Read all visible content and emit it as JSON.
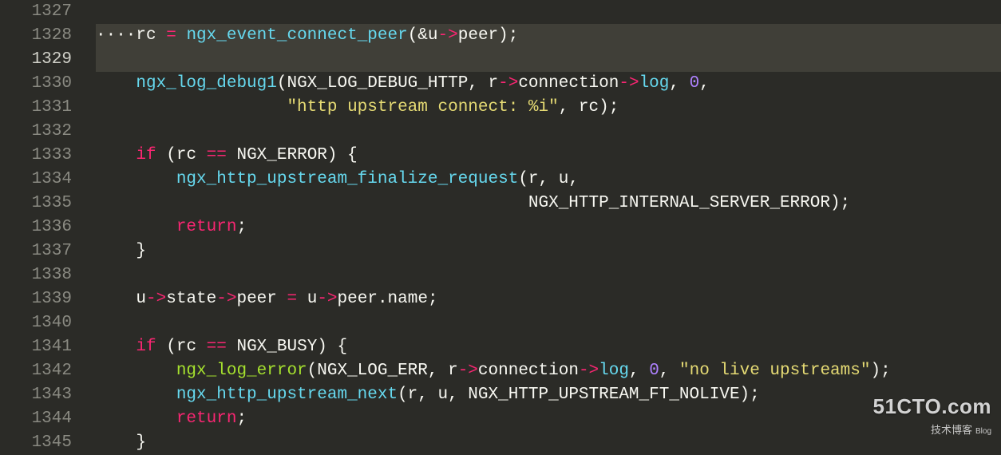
{
  "gutter": {
    "start": 1327,
    "end": 1345,
    "current": 1329
  },
  "code": {
    "lines": [
      {
        "n": 1327,
        "tokens": []
      },
      {
        "n": 1328,
        "highlight": true,
        "tokens": [
          {
            "t": "indent-guide",
            "v": "····"
          },
          {
            "t": "var",
            "v": "rc "
          },
          {
            "t": "eq",
            "v": "= "
          },
          {
            "t": "fn",
            "v": "ngx_event_connect_peer"
          },
          {
            "t": "par",
            "v": "(&u"
          },
          {
            "t": "ptr",
            "v": "->"
          },
          {
            "t": "prop",
            "v": "peer);"
          }
        ]
      },
      {
        "n": 1329,
        "current": true,
        "tokens": []
      },
      {
        "n": 1330,
        "tokens": [
          {
            "t": "var",
            "v": "    "
          },
          {
            "t": "fn",
            "v": "ngx_log_debug1"
          },
          {
            "t": "par",
            "v": "(NGX_LOG_DEBUG_HTTP, r"
          },
          {
            "t": "ptr",
            "v": "->"
          },
          {
            "t": "prop",
            "v": "connection"
          },
          {
            "t": "ptr",
            "v": "->"
          },
          {
            "t": "mem",
            "v": "log"
          },
          {
            "t": "par",
            "v": ", "
          },
          {
            "t": "num",
            "v": "0"
          },
          {
            "t": "par",
            "v": ","
          }
        ]
      },
      {
        "n": 1331,
        "tokens": [
          {
            "t": "var",
            "v": "                   "
          },
          {
            "t": "str",
            "v": "\"http upstream connect: %i\""
          },
          {
            "t": "par",
            "v": ", rc);"
          }
        ]
      },
      {
        "n": 1332,
        "tokens": []
      },
      {
        "n": 1333,
        "tokens": [
          {
            "t": "var",
            "v": "    "
          },
          {
            "t": "kw",
            "v": "if"
          },
          {
            "t": "par",
            "v": " (rc "
          },
          {
            "t": "op",
            "v": "=="
          },
          {
            "t": "par",
            "v": " NGX_ERROR) {"
          }
        ]
      },
      {
        "n": 1334,
        "tokens": [
          {
            "t": "var",
            "v": "        "
          },
          {
            "t": "fn",
            "v": "ngx_http_upstream_finalize_request"
          },
          {
            "t": "par",
            "v": "(r, u,"
          }
        ]
      },
      {
        "n": 1335,
        "tokens": [
          {
            "t": "var",
            "v": "                                           NGX_HTTP_INTERNAL_SERVER_ERROR);"
          }
        ]
      },
      {
        "n": 1336,
        "tokens": [
          {
            "t": "var",
            "v": "        "
          },
          {
            "t": "kw",
            "v": "return"
          },
          {
            "t": "par",
            "v": ";"
          }
        ]
      },
      {
        "n": 1337,
        "tokens": [
          {
            "t": "par",
            "v": "    }"
          }
        ]
      },
      {
        "n": 1338,
        "tokens": []
      },
      {
        "n": 1339,
        "tokens": [
          {
            "t": "var",
            "v": "    u"
          },
          {
            "t": "ptr",
            "v": "->"
          },
          {
            "t": "prop",
            "v": "state"
          },
          {
            "t": "ptr",
            "v": "->"
          },
          {
            "t": "prop",
            "v": "peer "
          },
          {
            "t": "eq",
            "v": "= "
          },
          {
            "t": "var",
            "v": "u"
          },
          {
            "t": "ptr",
            "v": "->"
          },
          {
            "t": "prop",
            "v": "peer.name;"
          }
        ]
      },
      {
        "n": 1340,
        "tokens": []
      },
      {
        "n": 1341,
        "tokens": [
          {
            "t": "var",
            "v": "    "
          },
          {
            "t": "kw",
            "v": "if"
          },
          {
            "t": "par",
            "v": " (rc "
          },
          {
            "t": "op",
            "v": "=="
          },
          {
            "t": "par",
            "v": " NGX_BUSY) {"
          }
        ]
      },
      {
        "n": 1342,
        "tokens": [
          {
            "t": "var",
            "v": "        "
          },
          {
            "t": "call",
            "v": "ngx_log_error"
          },
          {
            "t": "par",
            "v": "(NGX_LOG_ERR, r"
          },
          {
            "t": "ptr",
            "v": "->"
          },
          {
            "t": "prop",
            "v": "connection"
          },
          {
            "t": "ptr",
            "v": "->"
          },
          {
            "t": "mem",
            "v": "log"
          },
          {
            "t": "par",
            "v": ", "
          },
          {
            "t": "num",
            "v": "0"
          },
          {
            "t": "par",
            "v": ", "
          },
          {
            "t": "str",
            "v": "\"no live upstreams\""
          },
          {
            "t": "par",
            "v": ");"
          }
        ]
      },
      {
        "n": 1343,
        "tokens": [
          {
            "t": "var",
            "v": "        "
          },
          {
            "t": "fn",
            "v": "ngx_http_upstream_next"
          },
          {
            "t": "par",
            "v": "(r, u, NGX_HTTP_UPSTREAM_FT_NOLIVE);"
          }
        ]
      },
      {
        "n": 1344,
        "tokens": [
          {
            "t": "var",
            "v": "        "
          },
          {
            "t": "kw",
            "v": "return"
          },
          {
            "t": "par",
            "v": ";"
          }
        ]
      },
      {
        "n": 1345,
        "tokens": [
          {
            "t": "par",
            "v": "    }"
          }
        ]
      }
    ]
  },
  "watermark": {
    "line1": "51CTO.com",
    "line2": "技术博客",
    "tag": "Blog"
  }
}
